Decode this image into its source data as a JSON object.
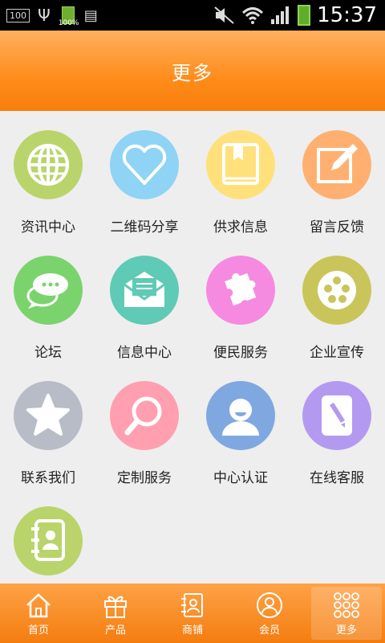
{
  "status_bar": {
    "left_box": "100",
    "battery_small_pct": "100%",
    "time": "15:37"
  },
  "header": {
    "title": "更多"
  },
  "colors": {
    "accent": "#f78a18",
    "tile_news": "#b9d46b",
    "tile_qrcode": "#8fd3f5",
    "tile_supply": "#ffe07a",
    "tile_message": "#ffb070",
    "tile_forum": "#7bd36d",
    "tile_info": "#5fcab5",
    "tile_services": "#f58ae0",
    "tile_enterprise": "#c9c55a",
    "tile_contact": "#b8bcc6",
    "tile_custom": "#ff9fb0",
    "tile_verify": "#7fa8e0",
    "tile_support": "#b39af0",
    "tile_contacts": "#b9d46b"
  },
  "grid": {
    "items": [
      {
        "label": "资讯中心",
        "icon": "globe-icon"
      },
      {
        "label": "二维码分享",
        "icon": "heart-icon"
      },
      {
        "label": "供求信息",
        "icon": "book-icon"
      },
      {
        "label": "留言反馈",
        "icon": "edit-icon"
      },
      {
        "label": "论坛",
        "icon": "chat-icon"
      },
      {
        "label": "信息中心",
        "icon": "mail-icon"
      },
      {
        "label": "便民服务",
        "icon": "puzzle-icon"
      },
      {
        "label": "企业宣传",
        "icon": "film-reel-icon"
      },
      {
        "label": "联系我们",
        "icon": "star-icon"
      },
      {
        "label": "定制服务",
        "icon": "search-icon"
      },
      {
        "label": "中心认证",
        "icon": "user-icon"
      },
      {
        "label": "在线客服",
        "icon": "document-pen-icon"
      },
      {
        "label": "",
        "icon": "contact-book-icon"
      }
    ]
  },
  "bottom_nav": {
    "items": [
      {
        "label": "首页",
        "icon": "home-icon"
      },
      {
        "label": "产品",
        "icon": "gift-icon"
      },
      {
        "label": "商铺",
        "icon": "shop-icon"
      },
      {
        "label": "会员",
        "icon": "member-icon"
      },
      {
        "label": "更多",
        "icon": "more-grid-icon",
        "active": true
      }
    ]
  }
}
